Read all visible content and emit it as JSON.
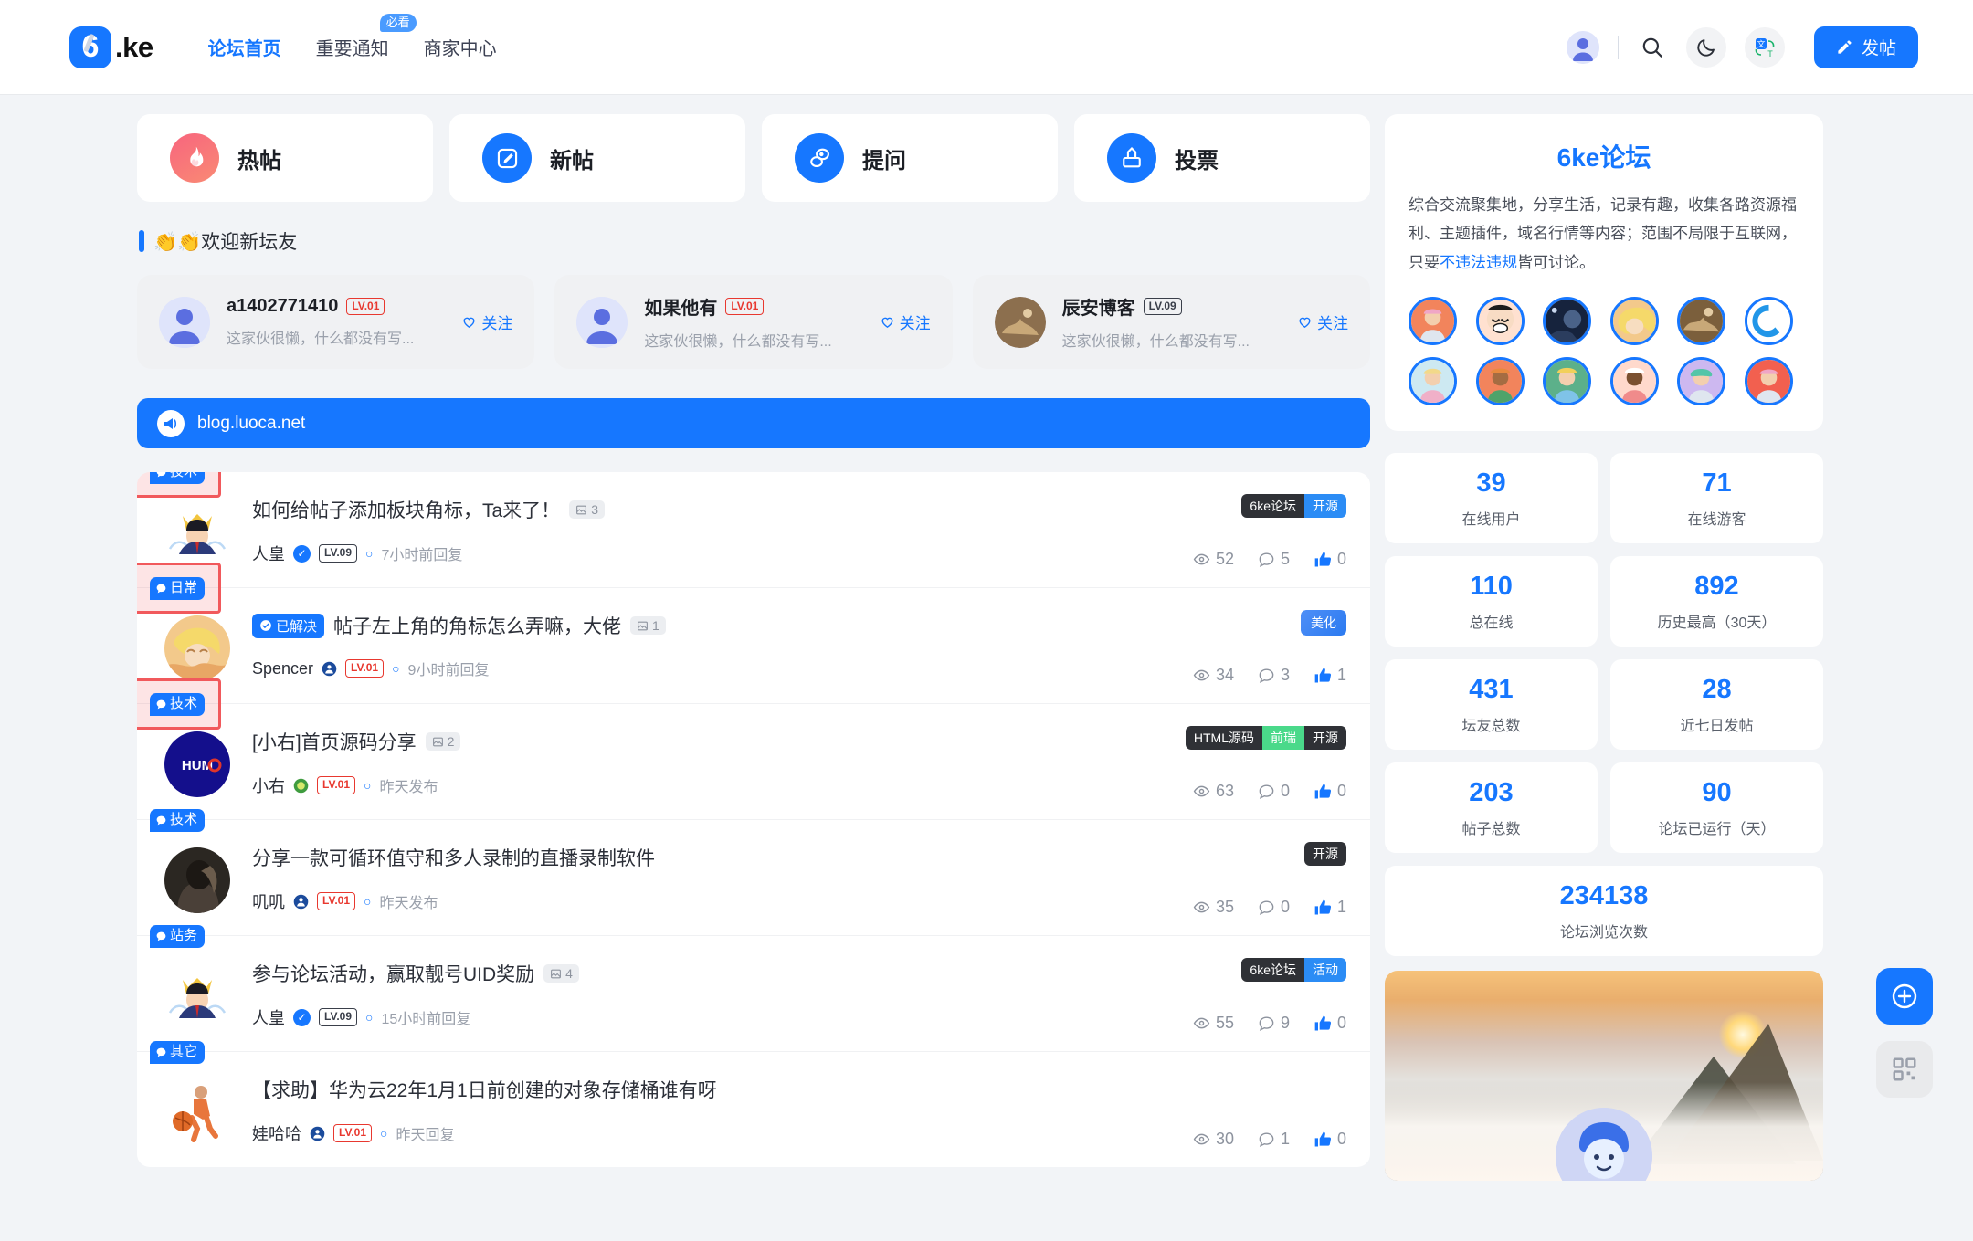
{
  "header": {
    "logo_text": ".ke",
    "logo_char": "6",
    "nav": [
      {
        "label": "论坛首页",
        "active": true,
        "badge": null
      },
      {
        "label": "重要通知",
        "active": false,
        "badge": "必看"
      },
      {
        "label": "商家中心",
        "active": false,
        "badge": null
      }
    ],
    "icons": {
      "avatar": "user-avatar",
      "search": "search-icon",
      "dark_mode": "moon-icon",
      "translate": "translate-icon"
    },
    "post_button": "发帖"
  },
  "categories": [
    {
      "label": "热帖",
      "icon": "flame-icon",
      "color": "#f86a7e"
    },
    {
      "label": "新帖",
      "icon": "pen-square-icon",
      "color": "#1677ff"
    },
    {
      "label": "提问",
      "icon": "question-bubble-icon",
      "color": "#1677ff"
    },
    {
      "label": "投票",
      "icon": "vote-box-icon",
      "color": "#1677ff"
    }
  ],
  "welcome": {
    "title": "👏👏欢迎新坛友",
    "follow_label": "关注",
    "users": [
      {
        "name": "a1402771410",
        "level": "LV.01",
        "level_style": "red",
        "desc": "这家伙很懒，什么都没有写..."
      },
      {
        "name": "如果他有",
        "level": "LV.01",
        "level_style": "red",
        "desc": "这家伙很懒，什么都没有写..."
      },
      {
        "name": "辰安博客",
        "level": "LV.09",
        "level_style": "dark",
        "desc": "这家伙很懒，什么都没有写..."
      }
    ]
  },
  "announcement": {
    "text": "blog.luoca.net",
    "icon": "megaphone-icon"
  },
  "posts": [
    {
      "category": "技术",
      "highlight": true,
      "title": "如何给帖子添加板块角标，Ta来了！",
      "solved": null,
      "images": "3",
      "author": "人皇",
      "verified": true,
      "level": "LV.09",
      "level_style": "dark",
      "time": "7小时前回复",
      "badges": [
        {
          "text": "6ke论坛",
          "style": "dark"
        },
        {
          "text": "开源",
          "style": "blue"
        }
      ],
      "views": "52",
      "comments": "5",
      "likes": "0",
      "liked": false
    },
    {
      "category": "日常",
      "highlight": true,
      "title": "帖子左上角的角标怎么弄嘛，大佬",
      "solved": "已解决",
      "images": "1",
      "author": "Spencer",
      "verified": false,
      "level": "LV.01",
      "level_style": "red",
      "time": "9小时前回复",
      "badges": [
        {
          "text": "美化",
          "style": "bluegrad"
        }
      ],
      "views": "34",
      "comments": "3",
      "likes": "1",
      "liked": true
    },
    {
      "category": "技术",
      "highlight": true,
      "title": "[小右]首页源码分享",
      "solved": null,
      "images": "2",
      "author": "小右",
      "verified": false,
      "level": "LV.01",
      "level_style": "red",
      "time": "昨天发布",
      "badges": [
        {
          "text": "HTML源码",
          "style": "dark"
        },
        {
          "text": "前瑞",
          "style": "green"
        },
        {
          "text": "开源",
          "style": "dark"
        }
      ],
      "views": "63",
      "comments": "0",
      "likes": "0",
      "liked": false
    },
    {
      "category": "技术",
      "highlight": false,
      "title": "分享一款可循环值守和多人录制的直播录制软件",
      "solved": null,
      "images": null,
      "author": "叽叽",
      "verified": false,
      "level": "LV.01",
      "level_style": "red",
      "time": "昨天发布",
      "badges": [
        {
          "text": "开源",
          "style": "dark"
        }
      ],
      "views": "35",
      "comments": "0",
      "likes": "1",
      "liked": true
    },
    {
      "category": "站务",
      "highlight": false,
      "title": "参与论坛活动，赢取靓号UID奖励",
      "solved": null,
      "images": "4",
      "author": "人皇",
      "verified": true,
      "level": "LV.09",
      "level_style": "dark",
      "time": "15小时前回复",
      "badges": [
        {
          "text": "6ke论坛",
          "style": "dark"
        },
        {
          "text": "活动",
          "style": "blue"
        }
      ],
      "views": "55",
      "comments": "9",
      "likes": "0",
      "liked": false
    },
    {
      "category": "其它",
      "highlight": false,
      "title": "【求助】华为云22年1月1日前创建的对象存储桶谁有呀",
      "solved": null,
      "images": null,
      "author": "娃哈哈",
      "verified": false,
      "level": "LV.01",
      "level_style": "red",
      "time": "昨天回复",
      "badges": [],
      "views": "30",
      "comments": "1",
      "likes": "0",
      "liked": false
    }
  ],
  "sidebar": {
    "title": "6ke论坛",
    "desc_part1": "综合交流聚集地，分享生活，记录有趣，收集各路资源福利、主题插件，域名行情等内容；范围不局限于互联网，只要",
    "desc_link": "不违法违规",
    "desc_part2": "皆可讨论。",
    "avatars_count": 12,
    "stats": [
      {
        "num": "39",
        "label": "在线用户"
      },
      {
        "num": "71",
        "label": "在线游客"
      },
      {
        "num": "110",
        "label": "总在线"
      },
      {
        "num": "892",
        "label": "历史最高（30天）"
      },
      {
        "num": "431",
        "label": "坛友总数"
      },
      {
        "num": "28",
        "label": "近七日发帖"
      },
      {
        "num": "203",
        "label": "帖子总数"
      },
      {
        "num": "90",
        "label": "论坛已运行（天）"
      },
      {
        "num": "234138",
        "label": "论坛浏览次数",
        "full": true
      }
    ]
  },
  "floating": [
    {
      "icon": "plus-circle-icon",
      "style": "blue"
    },
    {
      "icon": "qr-code-icon",
      "style": "grey"
    }
  ],
  "colors": {
    "accent": "#1677ff",
    "danger": "#e8382f",
    "highlight": "#f1595c"
  }
}
